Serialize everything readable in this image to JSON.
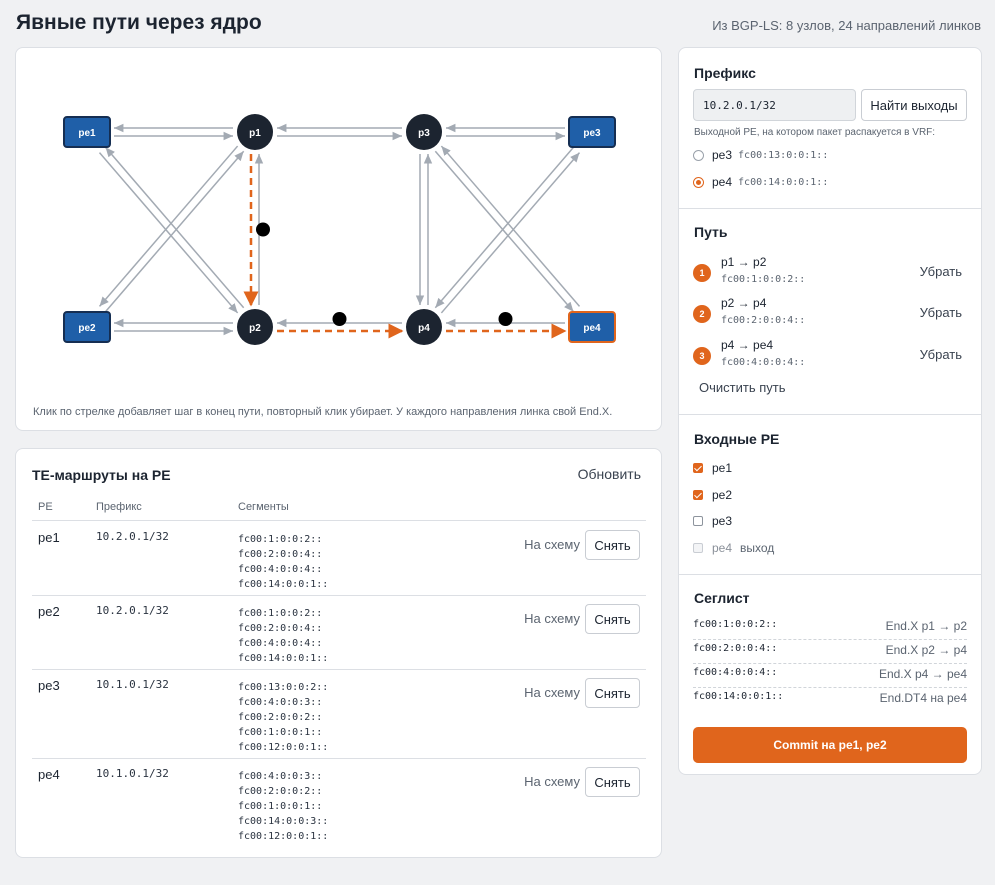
{
  "header": {
    "title": "Явные пути через ядро",
    "stats": "Из BGP-LS: 8 узлов, 24 направлений линков"
  },
  "graph": {
    "hint": "Клик по стрелке добавляет шаг в конец пути, повторный клик убирает. У каждого направления линка свой End.X.",
    "nodes": [
      {
        "id": "pe1",
        "label": "pe1",
        "kind": "pe"
      },
      {
        "id": "p1",
        "label": "p1",
        "kind": "p"
      },
      {
        "id": "p3",
        "label": "p3",
        "kind": "p"
      },
      {
        "id": "pe3",
        "label": "pe3",
        "kind": "pe"
      },
      {
        "id": "pe2",
        "label": "pe2",
        "kind": "pe"
      },
      {
        "id": "p2",
        "label": "p2",
        "kind": "p"
      },
      {
        "id": "p4",
        "label": "p4",
        "kind": "p"
      },
      {
        "id": "pe4",
        "label": "pe4",
        "kind": "pe",
        "selected": true
      }
    ],
    "links": [
      [
        "pe1",
        "p1"
      ],
      [
        "pe1",
        "p2"
      ],
      [
        "pe2",
        "p1"
      ],
      [
        "pe2",
        "p2"
      ],
      [
        "p1",
        "p3"
      ],
      [
        "p1",
        "p2"
      ],
      [
        "p2",
        "p4"
      ],
      [
        "p3",
        "p4"
      ],
      [
        "p3",
        "pe3"
      ],
      [
        "p3",
        "pe4"
      ],
      [
        "p4",
        "pe3"
      ],
      [
        "p4",
        "pe4"
      ]
    ],
    "path": [
      [
        "p1",
        "p2"
      ],
      [
        "p2",
        "p4"
      ],
      [
        "p4",
        "pe4"
      ]
    ],
    "colors": {
      "pe": "#1f5fa8",
      "p": "#1c2430",
      "link": "#a3aab3",
      "path": "#e0651c"
    }
  },
  "routes": {
    "title": "TE-маршруты на PE",
    "refresh_label": "Обновить",
    "columns": [
      "PE",
      "Префикс",
      "Сегменты"
    ],
    "show_label": "На схему",
    "remove_label": "Снять",
    "rows": [
      {
        "pe": "pe1",
        "prefix": "10.2.0.1/32",
        "segments": [
          "fc00:1:0:0:2::",
          "fc00:2:0:0:4::",
          "fc00:4:0:0:4::",
          "fc00:14:0:0:1::"
        ]
      },
      {
        "pe": "pe2",
        "prefix": "10.2.0.1/32",
        "segments": [
          "fc00:1:0:0:2::",
          "fc00:2:0:0:4::",
          "fc00:4:0:0:4::",
          "fc00:14:0:0:1::"
        ]
      },
      {
        "pe": "pe3",
        "prefix": "10.1.0.1/32",
        "segments": [
          "fc00:13:0:0:2::",
          "fc00:4:0:0:3::",
          "fc00:2:0:0:2::",
          "fc00:1:0:0:1::",
          "fc00:12:0:0:1::"
        ]
      },
      {
        "pe": "pe4",
        "prefix": "10.1.0.1/32",
        "segments": [
          "fc00:4:0:0:3::",
          "fc00:2:0:0:2::",
          "fc00:1:0:0:1::",
          "fc00:14:0:0:3::",
          "fc00:12:0:0:1::"
        ]
      }
    ]
  },
  "prefix": {
    "title": "Префикс",
    "value": "10.2.0.1/32",
    "find_label": "Найти выходы",
    "note": "Выходной PE, на котором пакет распакуется в VRF:",
    "options": [
      {
        "pe": "pe3",
        "addr": "fc00:13:0:0:1::",
        "selected": false
      },
      {
        "pe": "pe4",
        "addr": "fc00:14:0:0:1::",
        "selected": true
      }
    ]
  },
  "path": {
    "title": "Путь",
    "remove_label": "Убрать",
    "clear_label": "Очистить путь",
    "steps": [
      {
        "num": "1",
        "label": "p1 → p2",
        "sid": "fc00:1:0:0:2::"
      },
      {
        "num": "2",
        "label": "p2 → p4",
        "sid": "fc00:2:0:0:4::"
      },
      {
        "num": "3",
        "label": "p4 → pe4",
        "sid": "fc00:4:0:0:4::"
      }
    ]
  },
  "ingress": {
    "title": "Входные PE",
    "items": [
      {
        "pe": "pe1",
        "checked": true,
        "disabled": false,
        "extra": ""
      },
      {
        "pe": "pe2",
        "checked": true,
        "disabled": false,
        "extra": ""
      },
      {
        "pe": "pe3",
        "checked": false,
        "disabled": false,
        "extra": ""
      },
      {
        "pe": "pe4",
        "checked": false,
        "disabled": true,
        "extra": "выход"
      }
    ]
  },
  "seglist": {
    "title": "Сеглист",
    "items": [
      {
        "sid": "fc00:1:0:0:2::",
        "desc": "End.X p1 → p2"
      },
      {
        "sid": "fc00:2:0:0:4::",
        "desc": "End.X p2 → p4"
      },
      {
        "sid": "fc00:4:0:0:4::",
        "desc": "End.X p4 → pe4"
      },
      {
        "sid": "fc00:14:0:0:1::",
        "desc": "End.DT4 на pe4"
      }
    ],
    "commit_label": "Commit на pe1, pe2"
  }
}
